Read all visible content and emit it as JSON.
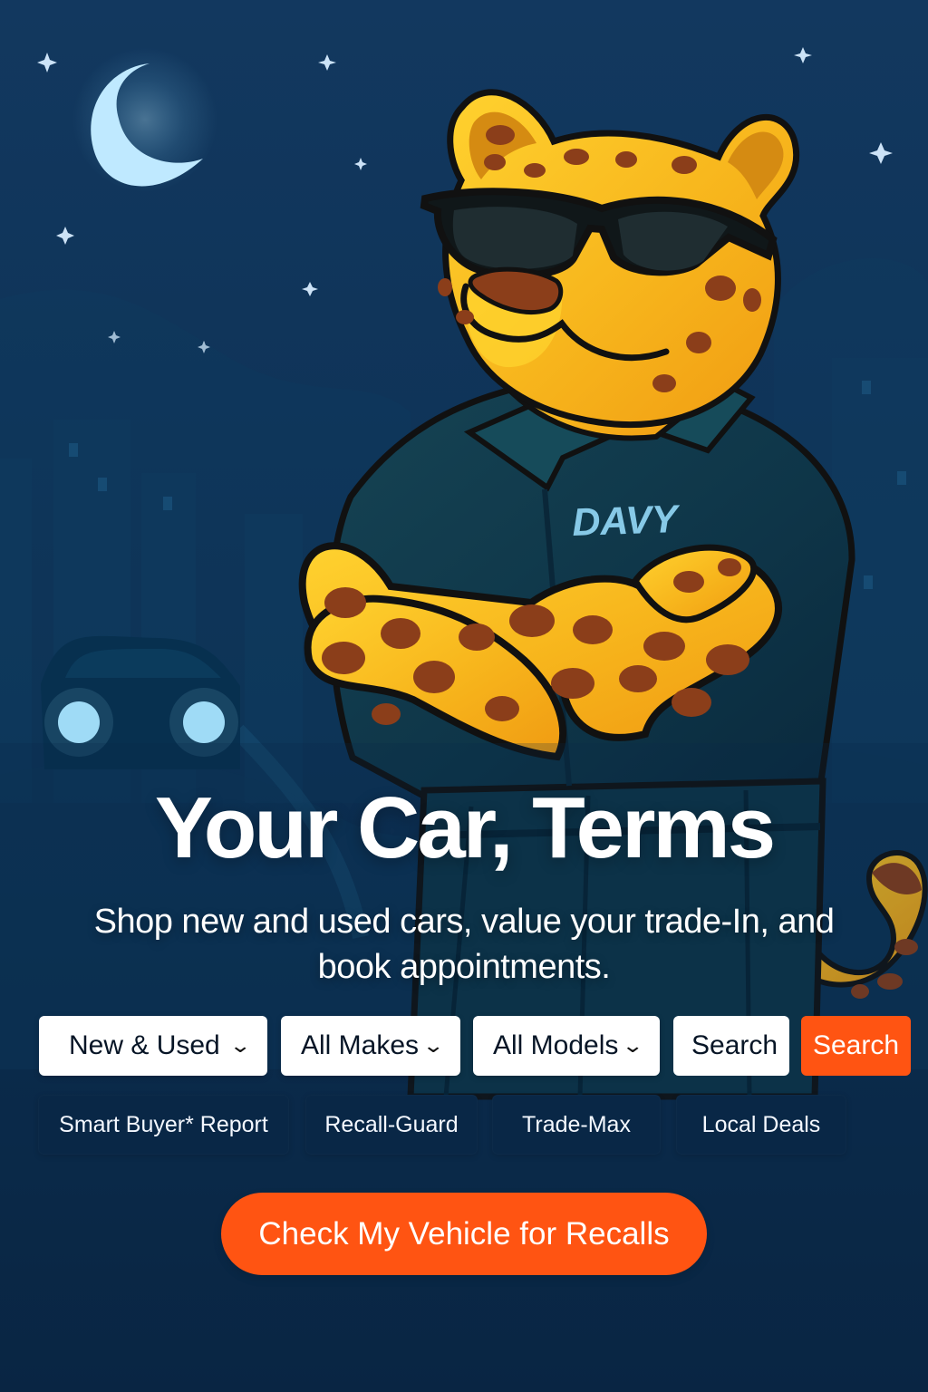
{
  "hero": {
    "shirt_name": "DAVY",
    "title": "Your Car,  Terms",
    "subtitle_line_1": "Shop new and used cars, value your trade-In,  and",
    "subtitle_line_2": "book appointments."
  },
  "filters": {
    "vehicle_type": "New & Used",
    "make": "All Makes",
    "model": "All Models",
    "search_placeholder": "Search",
    "search_button": "Search"
  },
  "features": [
    {
      "label": "Smart Buyer* Report"
    },
    {
      "label": "Recall-Guard"
    },
    {
      "label": "Trade-Max"
    },
    {
      "label": "Local Deals"
    }
  ],
  "cta": {
    "label": "Check My Vehicle for Recalls"
  },
  "icons": {
    "dropdown": "chevron-down-icon",
    "moon": "moon-icon",
    "stars": "star-icon",
    "car": "car-icon"
  },
  "colors": {
    "background": "#0f2d4d",
    "accent": "#ff5412",
    "mascot": "#f5b51a",
    "shirt": "#10384f",
    "feature_button": "#092746"
  }
}
